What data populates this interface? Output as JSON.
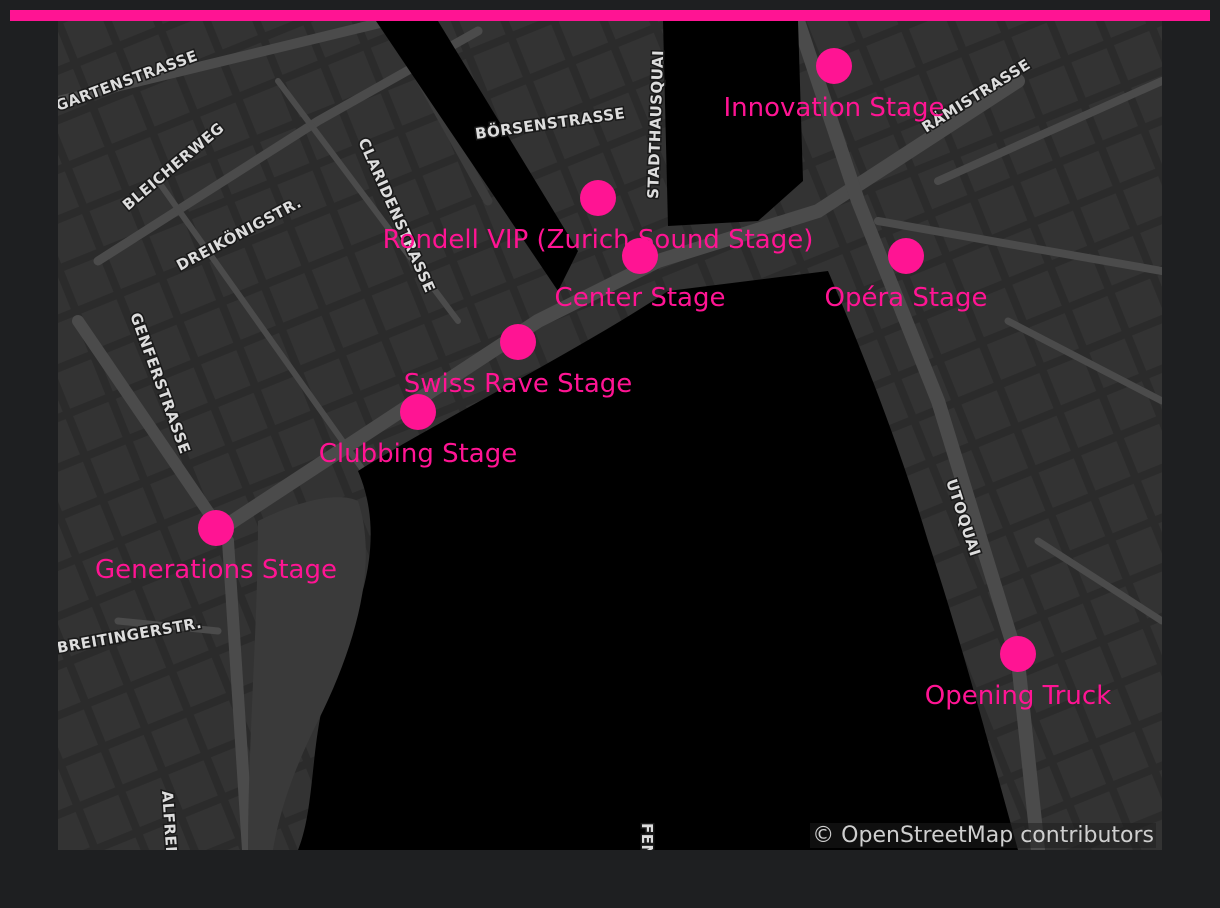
{
  "colors": {
    "accent": "#ff1493",
    "water": "#000000",
    "land": "#2b2b2b",
    "road": "#4a4a4a",
    "page_bg": "#1e1f21"
  },
  "streets": {
    "gartenstrasse": "GARTENSTRASSE",
    "bleicherweg": "BLEICHERWEG",
    "dreikoenigstr": "DREIKÖNIGSTR.",
    "claridenstrasse": "CLARIDENSTRASSE",
    "boersenstrasse": "BÖRSENSTRASSE",
    "stadthausquai": "STADTHAUSQUAI",
    "ramistrasse": "RÄMISTRASSE",
    "genferstrasse": "GENFERSTRASSE",
    "breitingerstr": "BREITINGERSTR.",
    "utoquai": "UTOQUAI",
    "alfred": "ALFRED",
    "fen": "FEN"
  },
  "stages": [
    {
      "label": "Innovation Stage"
    },
    {
      "label": "Rondell VIP (Zurich Sound Stage)"
    },
    {
      "label": "Center Stage"
    },
    {
      "label": "Opéra Stage"
    },
    {
      "label": "Swiss Rave Stage"
    },
    {
      "label": "Clubbing Stage"
    },
    {
      "label": "Generations Stage"
    },
    {
      "label": "Opening Truck"
    }
  ],
  "attribution": "© OpenStreetMap contributors"
}
